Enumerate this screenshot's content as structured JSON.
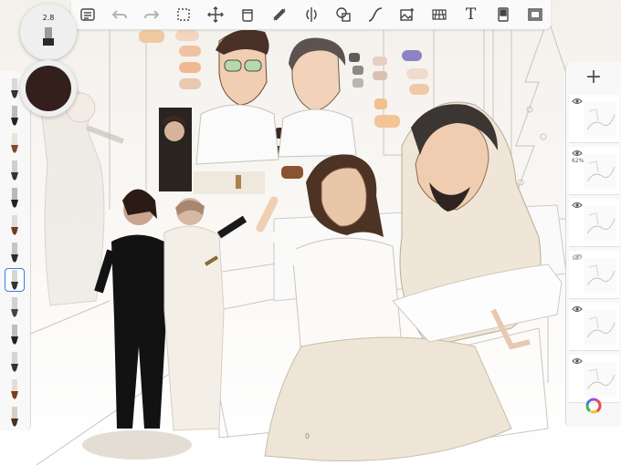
{
  "app": {
    "accent_color": "#3a7fe0"
  },
  "toolbar": {
    "items": [
      {
        "name": "gallery-icon",
        "state": "enabled"
      },
      {
        "name": "undo-icon",
        "state": "disabled"
      },
      {
        "name": "redo-icon",
        "state": "disabled"
      },
      {
        "name": "selection-icon",
        "state": "enabled"
      },
      {
        "name": "transform-icon",
        "state": "enabled"
      },
      {
        "name": "fill-icon",
        "state": "enabled"
      },
      {
        "name": "guides-icon",
        "state": "enabled"
      },
      {
        "name": "symmetry-icon",
        "state": "enabled"
      },
      {
        "name": "shapes-icon",
        "state": "enabled"
      },
      {
        "name": "curve-icon",
        "state": "enabled"
      },
      {
        "name": "image-icon",
        "state": "enabled"
      },
      {
        "name": "perspective-icon",
        "state": "enabled"
      },
      {
        "name": "text-tool",
        "state": "enabled"
      },
      {
        "name": "stamp-icon",
        "state": "enabled"
      },
      {
        "name": "fullscreen-icon",
        "state": "enabled"
      }
    ],
    "text_tool_label": "T"
  },
  "brush_size": {
    "value": "2.8"
  },
  "current_color": {
    "hex": "#33201c"
  },
  "brushes": [
    {
      "name": "brush-pencil",
      "tip": "#333333",
      "body": "#d8d8d8",
      "selected": false
    },
    {
      "name": "brush-ink-pen",
      "tip": "#222222",
      "body": "#bcbcbc",
      "selected": false
    },
    {
      "name": "brush-nib",
      "tip": "#7a4a2e",
      "body": "#e9e3da",
      "selected": false
    },
    {
      "name": "brush-technical",
      "tip": "#333333",
      "body": "#cfcfcf",
      "selected": false
    },
    {
      "name": "brush-fineliner",
      "tip": "#222222",
      "body": "#b9b9b9",
      "selected": false
    },
    {
      "name": "brush-round",
      "tip": "#6b3e24",
      "body": "#e1dcd5",
      "selected": false
    },
    {
      "name": "brush-flat",
      "tip": "#2b2b2b",
      "body": "#c4c4c4",
      "selected": false
    },
    {
      "name": "brush-airbrush",
      "tip": "#333333",
      "body": "#d6d6d6",
      "selected": true
    },
    {
      "name": "brush-blender",
      "tip": "#444444",
      "body": "#d1d1d1",
      "selected": false
    },
    {
      "name": "brush-marker",
      "tip": "#222222",
      "body": "#bdbdbd",
      "selected": false
    },
    {
      "name": "brush-paint",
      "tip": "#333333",
      "body": "#d4d4d4",
      "selected": false
    },
    {
      "name": "brush-chisel",
      "tip": "#7a3e1c",
      "body": "#e6ded4",
      "selected": false
    },
    {
      "name": "brush-charcoal",
      "tip": "#4a3020",
      "body": "#d8d0c6",
      "selected": false
    }
  ],
  "layers": {
    "add_label": "+",
    "items": [
      {
        "name": "layer-1",
        "visible": true,
        "opacity": ""
      },
      {
        "name": "layer-2",
        "visible": true,
        "opacity": "62%"
      },
      {
        "name": "layer-3",
        "visible": true,
        "opacity": ""
      },
      {
        "name": "layer-4",
        "visible": false,
        "opacity": ""
      },
      {
        "name": "layer-5",
        "visible": true,
        "opacity": ""
      },
      {
        "name": "layer-6",
        "visible": true,
        "opacity": ""
      }
    ]
  },
  "canvas": {
    "readout": "0"
  }
}
